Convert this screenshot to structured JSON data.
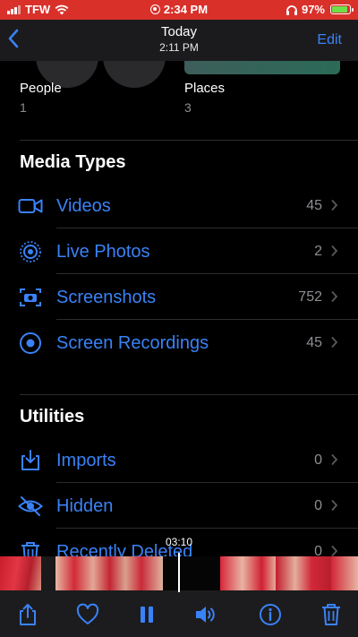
{
  "status_bar": {
    "carrier": "TFW",
    "time": "2:34 PM",
    "battery_percent": "97%",
    "battery_level": 0.97,
    "background_color": "#d9302a"
  },
  "nav": {
    "back_icon": "chevron-left-icon",
    "title": "Today",
    "subtitle": "2:11 PM",
    "edit_label": "Edit"
  },
  "albums": [
    {
      "name": "People",
      "count": "1"
    },
    {
      "name": "Places",
      "count": "3"
    }
  ],
  "media_types": {
    "title": "Media Types",
    "items": [
      {
        "label": "Videos",
        "count": "45",
        "icon": "video-camera-icon"
      },
      {
        "label": "Live Photos",
        "count": "2",
        "icon": "live-photo-icon"
      },
      {
        "label": "Screenshots",
        "count": "752",
        "icon": "screenshot-icon"
      },
      {
        "label": "Screen Recordings",
        "count": "45",
        "icon": "screen-recording-icon"
      }
    ]
  },
  "utilities": {
    "title": "Utilities",
    "items": [
      {
        "label": "Imports",
        "count": "0",
        "icon": "import-icon"
      },
      {
        "label": "Hidden",
        "count": "0",
        "icon": "eye-slash-icon"
      },
      {
        "label": "Recently Deleted",
        "count": "0",
        "icon": "trash-icon"
      }
    ]
  },
  "player": {
    "timecode": "03:10"
  },
  "toolbar": {
    "icons": [
      "share-icon",
      "heart-icon",
      "pause-icon",
      "volume-icon",
      "info-icon",
      "trash-icon"
    ]
  },
  "colors": {
    "accent": "#3a82f7",
    "secondary_text": "#8e8e93",
    "background": "#000000"
  }
}
